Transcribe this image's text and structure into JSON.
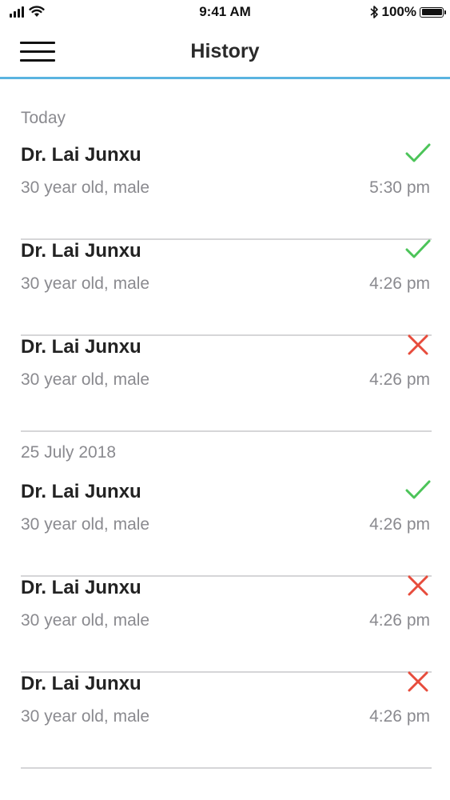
{
  "status_bar": {
    "time": "9:41 AM",
    "battery": "100%",
    "battery_level": 1.0
  },
  "header": {
    "title": "History",
    "menu_icon": "hamburger-menu-icon",
    "accent_color": "#5ab4e0"
  },
  "colors": {
    "success": "#4cc459",
    "failure": "#e74c3c"
  },
  "sections": [
    {
      "title": "Today",
      "items": [
        {
          "name": "Dr. Lai Junxu",
          "subtitle": "30 year old, male",
          "time": "5:30 pm",
          "status": "success",
          "icon": "checkmark-icon"
        },
        {
          "name": "Dr. Lai Junxu",
          "subtitle": "30 year old, male",
          "time": "4:26 pm",
          "status": "success",
          "icon": "checkmark-icon"
        },
        {
          "name": "Dr. Lai Junxu",
          "subtitle": "30 year old, male",
          "time": "4:26 pm",
          "status": "failure",
          "icon": "cross-icon"
        }
      ]
    },
    {
      "title": "25 July 2018",
      "items": [
        {
          "name": "Dr. Lai Junxu",
          "subtitle": "30 year old, male",
          "time": "4:26 pm",
          "status": "success",
          "icon": "checkmark-icon"
        },
        {
          "name": "Dr. Lai Junxu",
          "subtitle": "30 year old, male",
          "time": "4:26 pm",
          "status": "failure",
          "icon": "cross-icon"
        },
        {
          "name": "Dr. Lai Junxu",
          "subtitle": "30 year old, male",
          "time": "4:26 pm",
          "status": "failure",
          "icon": "cross-icon"
        }
      ]
    }
  ]
}
